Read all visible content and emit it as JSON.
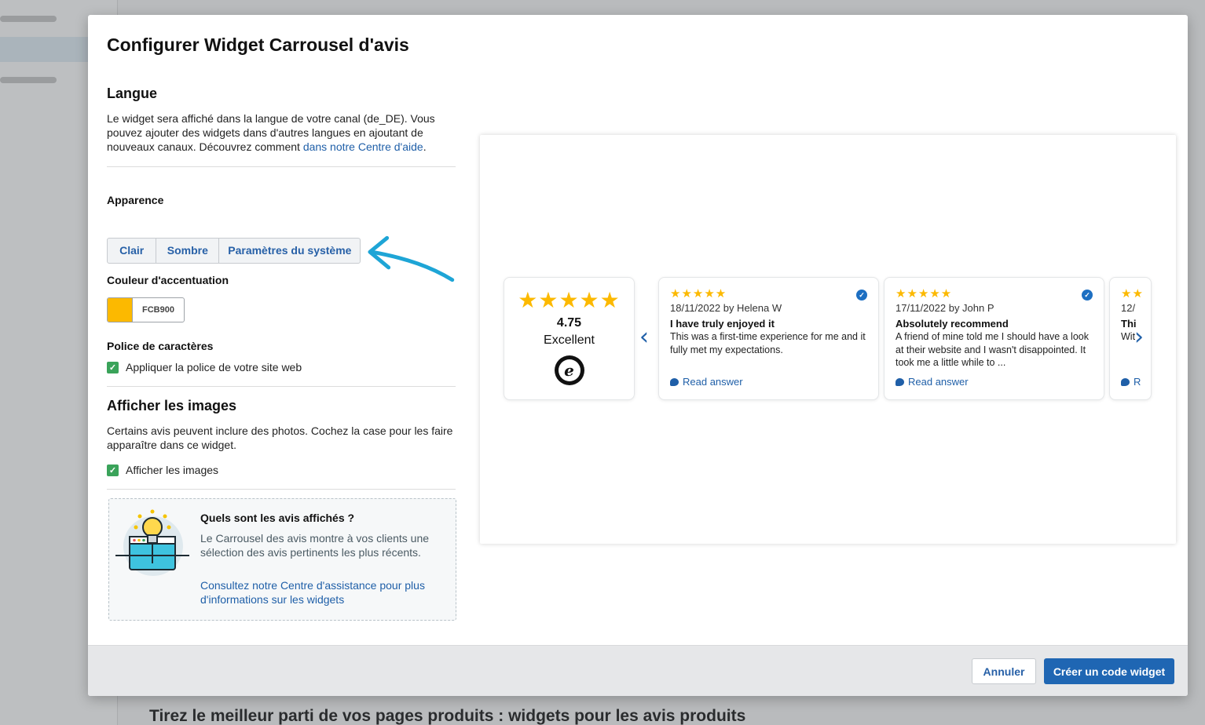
{
  "background": {
    "heading": "Tirez le meilleur parti de vos pages produits : widgets pour les avis produits"
  },
  "modal": {
    "title": "Configurer Widget Carrousel d'avis",
    "langue": {
      "heading": "Langue",
      "text": "Le widget sera affiché dans la langue de votre canal (de_DE). Vous pouvez ajouter des widgets dans d'autres langues en ajoutant de nouveaux canaux. Découvrez comment ",
      "link": "dans notre Centre d'aide",
      "text_end": "."
    },
    "apparence": {
      "label": "Apparence",
      "options": [
        "Clair",
        "Sombre",
        "Paramètres du système"
      ]
    },
    "accent": {
      "label": "Couleur d'accentuation",
      "hex": "FCB900",
      "color": "#FCB900"
    },
    "police": {
      "label": "Police de caractères",
      "checkbox": "Appliquer la police de votre site web"
    },
    "images": {
      "heading": "Afficher les images",
      "text": "Certains avis peuvent inclure des photos. Cochez la case pour les faire apparaître dans ce widget.",
      "checkbox": "Afficher les images"
    },
    "info": {
      "title": "Quels sont les avis affichés ?",
      "text": "Le Carrousel des avis montre à vos clients une sélection des avis pertinents les plus récents.",
      "link": "Consultez notre Centre d'assistance pour plus d'informations sur les widgets"
    },
    "preview": {
      "summary": {
        "stars": "★★★★★",
        "rating": "4.75",
        "label": "Excellent",
        "logo": "e"
      },
      "reviews": [
        {
          "stars": "★★★★★",
          "meta": "18/11/2022 by Helena W",
          "title": "I have truly enjoyed it",
          "body": "This was a first-time experience for me and it fully met my expectations.",
          "answer": "Read answer"
        },
        {
          "stars": "★★★★★",
          "meta": "17/11/2022 by John P",
          "title": "Absolutely recommend",
          "body": "A friend of mine told me I should have a look at their website and I wasn't disappointed. It took me a little while to ...",
          "answer": "Read answer"
        },
        {
          "stars": "★★",
          "meta": "12/",
          "title": "Thi",
          "body": "Wit",
          "answer": "R"
        }
      ],
      "prev_icon": "‹",
      "next_icon": "›"
    },
    "footer": {
      "cancel": "Annuler",
      "create": "Créer un code widget"
    }
  }
}
